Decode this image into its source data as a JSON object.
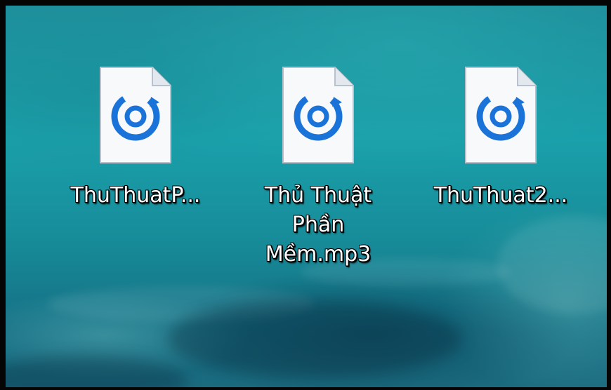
{
  "desktop": {
    "icons": [
      {
        "label": "ThuThuatP...",
        "icon": "media-file-icon"
      },
      {
        "label": "Thủ Thuật\nPhần\nMềm.mp3",
        "icon": "media-file-icon"
      },
      {
        "label": "ThuThuat2...",
        "icon": "media-file-icon"
      }
    ],
    "accent_color": "#1a73d9"
  }
}
